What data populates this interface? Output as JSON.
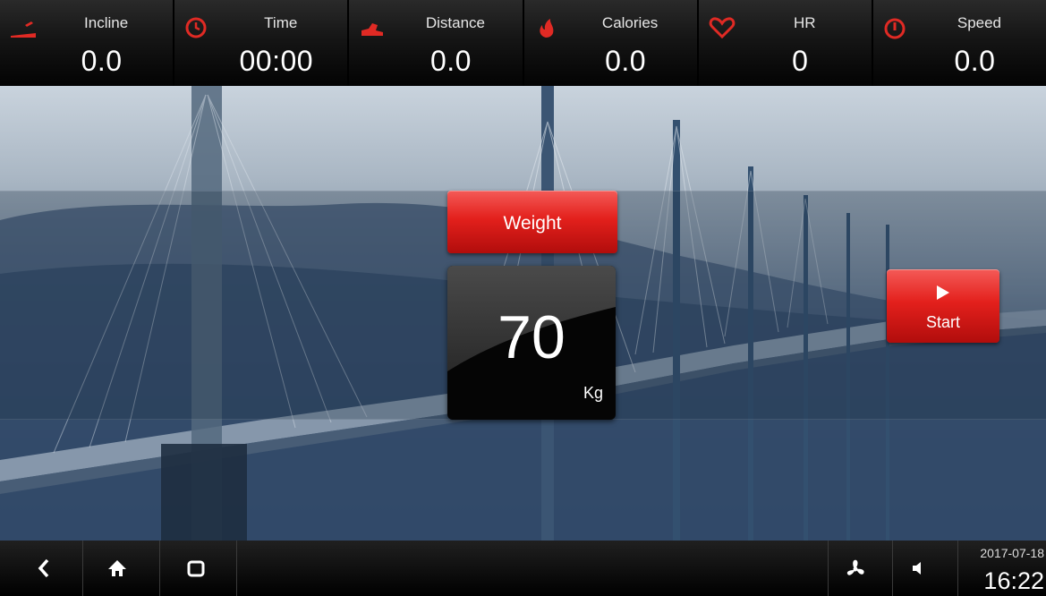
{
  "metrics": [
    {
      "id": "incline",
      "label": "Incline",
      "value": "0.0",
      "icon": "incline-icon"
    },
    {
      "id": "time",
      "label": "Time",
      "value": "00:00",
      "icon": "clock-icon"
    },
    {
      "id": "distance",
      "label": "Distance",
      "value": "0.0",
      "icon": "shoe-icon"
    },
    {
      "id": "calories",
      "label": "Calories",
      "value": "0.0",
      "icon": "flame-icon"
    },
    {
      "id": "hr",
      "label": "HR",
      "value": "0",
      "icon": "heart-icon"
    },
    {
      "id": "speed",
      "label": "Speed",
      "value": "0.0",
      "icon": "speedometer-icon"
    }
  ],
  "weight": {
    "button_label": "Weight",
    "value": "70",
    "unit": "Kg"
  },
  "start": {
    "label": "Start",
    "icon": "play-icon"
  },
  "navbar": {
    "back_icon": "back-icon",
    "home_icon": "home-icon",
    "recents_icon": "recents-icon",
    "fan_icon": "fan-icon",
    "volume_icon": "volume-icon",
    "date": "2017-07-18",
    "time": "16:22"
  },
  "colors": {
    "accent_red": "#e3201c",
    "icon_red": "#e02a24",
    "bar_dark": "#111111"
  }
}
